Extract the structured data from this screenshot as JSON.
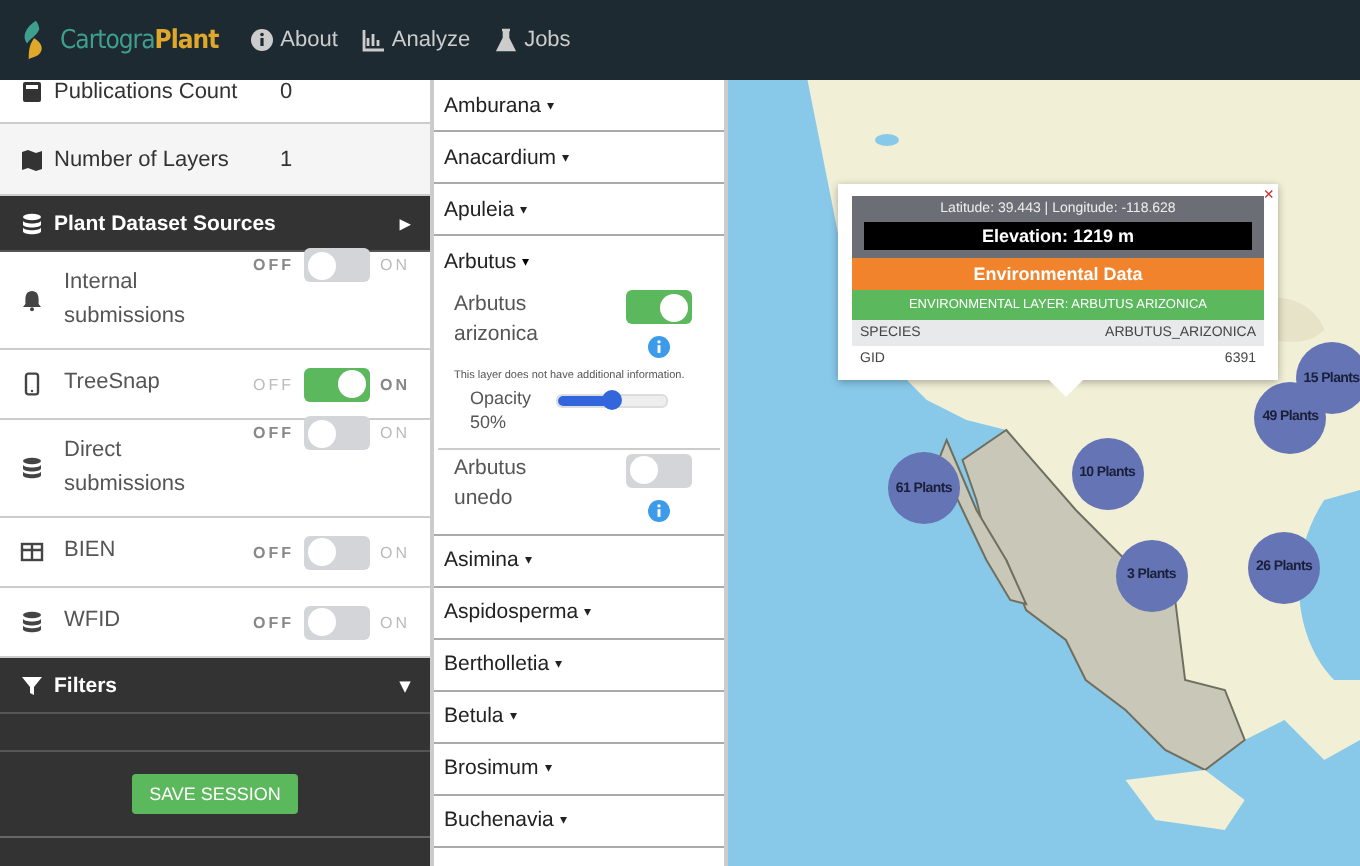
{
  "navbar": {
    "brand": [
      {
        "text": "Cartogra",
        "kind": "plain"
      },
      {
        "text": "Plant",
        "kind": "bold"
      }
    ],
    "links": [
      {
        "label": "About"
      },
      {
        "label": "Analyze"
      },
      {
        "label": "Jobs"
      }
    ]
  },
  "stats": [
    {
      "label": "Publications Count",
      "value": "0"
    },
    {
      "label": "Number of Layers",
      "value": "1"
    }
  ],
  "sources_header": {
    "title": "Plant Dataset Sources",
    "caret": "▸"
  },
  "sources": [
    {
      "name": "Internal submissions",
      "off_label": "OFF",
      "on_label": "ON",
      "on": false
    },
    {
      "name": "TreeSnap",
      "off_label": "OFF",
      "on_label": "ON",
      "on": true
    },
    {
      "name": "Direct submissions",
      "off_label": "OFF",
      "on_label": "ON",
      "on": false
    },
    {
      "name": "BIEN",
      "off_label": "OFF",
      "on_label": "ON",
      "on": false
    },
    {
      "name": "WFID",
      "off_label": "OFF",
      "on_label": "ON",
      "on": false
    }
  ],
  "filters_header": {
    "title": "Filters",
    "caret": "▾"
  },
  "save_button": "SAVE SESSION",
  "genera": [
    {
      "name": "Amburana",
      "caret": "▾",
      "expanded": false
    },
    {
      "name": "Anacardium",
      "caret": "▾",
      "expanded": false
    },
    {
      "name": "Apuleia",
      "caret": "▾",
      "expanded": false
    },
    {
      "name": "Arbutus",
      "caret": "▾",
      "expanded": true,
      "layers": [
        {
          "name": "Arbutus arizonica",
          "on": true,
          "note": "This layer does not have additional information.",
          "opacity_label": "Opacity",
          "opacity_value": "50%",
          "level": 0.5
        },
        {
          "name": "Arbutus unedo",
          "on": false
        }
      ]
    },
    {
      "name": "Asimina",
      "caret": "▾",
      "expanded": false
    },
    {
      "name": "Aspidosperma",
      "caret": "▾",
      "expanded": false
    },
    {
      "name": "Bertholletia",
      "caret": "▾",
      "expanded": false
    },
    {
      "name": "Betula",
      "caret": "▾",
      "expanded": false
    },
    {
      "name": "Brosimum",
      "caret": "▾",
      "expanded": false
    },
    {
      "name": "Buchenavia",
      "caret": "▾",
      "expanded": false
    }
  ],
  "map": {
    "kind": "picture",
    "popup": {
      "close": "×",
      "coords": "Latitude: 39.443 | Longitude: -118.628",
      "elevation": "Elevation: 1219 m",
      "section": "Environmental Data",
      "layer": "ENVIRONMENTAL LAYER: ARBUTUS ARIZONICA",
      "rows": [
        {
          "key": "SPECIES",
          "value": "ARBUTUS_ARIZONICA"
        },
        {
          "key": "GID",
          "value": "6391"
        }
      ]
    },
    "clusters": [
      {
        "label": "61 Plants"
      },
      {
        "label": "10 Plants"
      },
      {
        "label": "49 Plants"
      },
      {
        "label": "15 Plants"
      },
      {
        "label": "3 Plants"
      },
      {
        "label": "26 Plants"
      }
    ]
  }
}
